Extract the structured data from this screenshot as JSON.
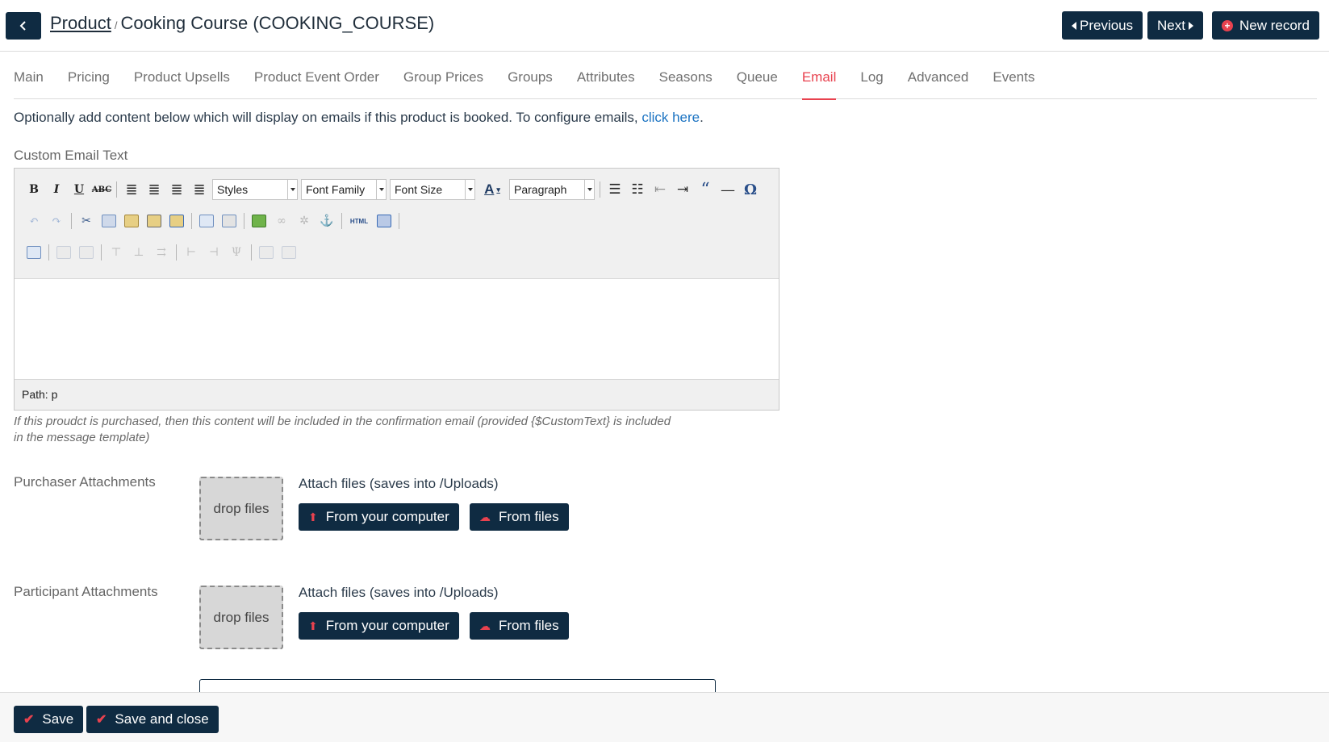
{
  "header": {
    "breadcrumb_link": "Product",
    "breadcrumb_sep": "/",
    "title": "Cooking Course (COOKING_COURSE)",
    "prev_label": "Previous",
    "next_label": "Next",
    "new_label": "New record"
  },
  "tabs": [
    {
      "label": "Main"
    },
    {
      "label": "Pricing"
    },
    {
      "label": "Product Upsells"
    },
    {
      "label": "Product Event Order"
    },
    {
      "label": "Group Prices"
    },
    {
      "label": "Groups"
    },
    {
      "label": "Attributes"
    },
    {
      "label": "Seasons"
    },
    {
      "label": "Queue"
    },
    {
      "label": "Email"
    },
    {
      "label": "Log"
    },
    {
      "label": "Advanced"
    },
    {
      "label": "Events"
    }
  ],
  "intro": {
    "text": "Optionally add content below which will display on emails if this product is booked. To configure emails, ",
    "link": "click here",
    "end": "."
  },
  "editor": {
    "label": "Custom Email Text",
    "styles_select": "Styles",
    "font_family_select": "Font Family",
    "font_size_select": "Font Size",
    "format_select": "Paragraph",
    "path": "Path: p",
    "help": "If this proudct is purchased, then this content will be included in the confirmation email (provided {$CustomText} is included in the message template)"
  },
  "purchaser": {
    "label": "Purchaser Attachments",
    "drop": "drop files",
    "attach_label": "Attach files (saves into /Uploads)",
    "computer_btn": "From your computer",
    "files_btn": "From files"
  },
  "participant": {
    "label": "Participant Attachments",
    "drop": "drop files",
    "attach_label": "Attach files (saves into /Uploads)",
    "computer_btn": "From your computer",
    "files_btn": "From files"
  },
  "footer": {
    "save": "Save",
    "save_close": "Save and close"
  },
  "colors": {
    "primary_dark": "#0f2b42",
    "accent_red": "#e8424f",
    "link_blue": "#1b73c2"
  }
}
